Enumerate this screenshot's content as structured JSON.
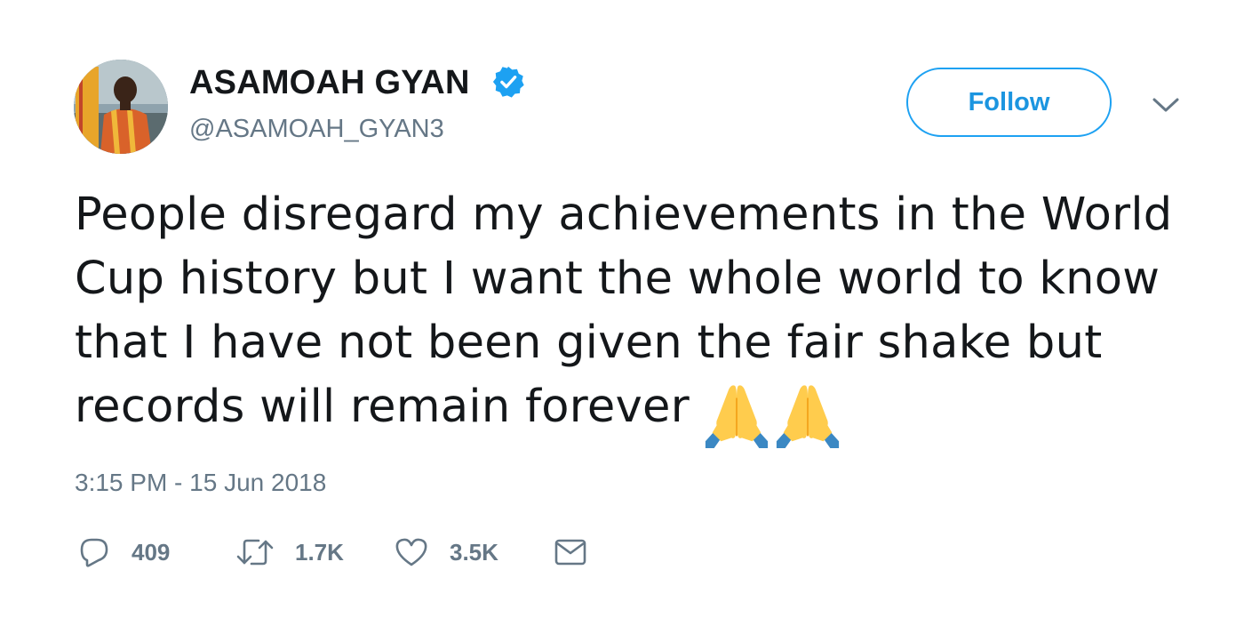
{
  "author": {
    "display_name": "ASAMOAH GYAN",
    "handle": "@ASAMOAH_GYAN3",
    "verified": true,
    "avatar_icon": "profile-photo"
  },
  "header": {
    "follow_label": "Follow",
    "menu_icon": "chevron-down-icon"
  },
  "tweet": {
    "text": "People disregard my achievements in the World Cup history but I want the whole world to know that I have not been given the fair shake but records will remain forever",
    "emojis": [
      "folded-hands",
      "folded-hands"
    ],
    "timestamp": "3:15 PM - 15 Jun 2018"
  },
  "actions": {
    "reply": {
      "icon": "reply-icon",
      "count": "409"
    },
    "retweet": {
      "icon": "retweet-icon",
      "count": "1.7K"
    },
    "like": {
      "icon": "heart-icon",
      "count": "3.5K"
    },
    "message": {
      "icon": "envelope-icon"
    }
  },
  "colors": {
    "accent": "#1da1f2",
    "text": "#14171a",
    "muted": "#657786",
    "verified": "#1da1f2"
  }
}
